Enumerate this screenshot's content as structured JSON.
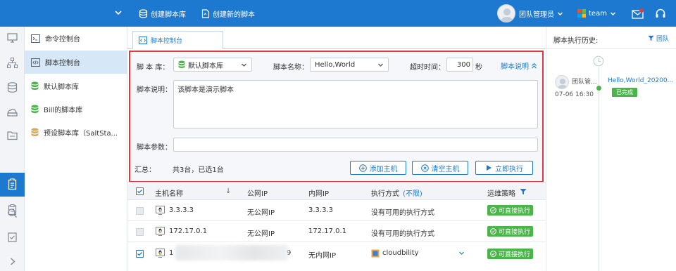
{
  "topbar": {
    "create_lib": "创建脚本库",
    "create_script": "创建新的脚本",
    "user_name": "团队管理员",
    "team_name": "team"
  },
  "sidebar": {
    "items": [
      {
        "label": "命令控制台",
        "icon": "terminal-icon"
      },
      {
        "label": "脚本控制台",
        "icon": "code-icon",
        "active": true
      },
      {
        "label": "默认脚本库",
        "icon": "database-icon",
        "color": "#4ab549"
      },
      {
        "label": "Bill的脚本库",
        "icon": "database-icon",
        "color": "#4ab549"
      },
      {
        "label": "预设脚本库（SaltSta...",
        "icon": "database-icon",
        "color": "#e0a64e"
      }
    ]
  },
  "tab": {
    "label": "脚本控制台"
  },
  "form": {
    "lib_label": "脚 本 库：",
    "lib_value": "默认脚本库",
    "name_label": "脚本名称：",
    "name_value": "Hello,World",
    "timeout_label": "超时时间：",
    "timeout_value": "300",
    "timeout_unit": "秒",
    "desc_toggle": "脚本说明",
    "desc_label": "脚本说明：",
    "desc_value": "该脚本是演示脚本",
    "param_label": "脚本参数：",
    "param_value": ""
  },
  "summary": {
    "label": "汇总：",
    "text": "共3台，已选1台",
    "add_host": "添加主机",
    "clear_host": "清空主机",
    "run_now": "立即执行"
  },
  "table": {
    "headers": {
      "host": "主机名称",
      "sort": "↓",
      "public_ip": "公网IP",
      "private_ip": "内网IP",
      "method": "执行方式",
      "method_filter": "(不限)",
      "policy": "运维策略"
    },
    "rows": [
      {
        "host": "3.3.3.3",
        "public_ip": "无公网IP",
        "private_ip": "3.3.3.3",
        "method": "没有可用的执行方式",
        "policy": "可直接执行",
        "checked": false,
        "disabled": true
      },
      {
        "host": "172.17.0.1",
        "public_ip": "无公网IP",
        "private_ip": "172.17.0.1",
        "method": "没有可用的执行方式",
        "policy": "可直接执行",
        "checked": false,
        "disabled": true
      },
      {
        "host": "1",
        "host_tail": "9",
        "public_ip": "无内网IP",
        "private_ip": "",
        "method": "cloudbility",
        "policy": "可直接执行",
        "checked": true,
        "disabled": false
      }
    ]
  },
  "history": {
    "title": "脚本执行历史:",
    "filter_label": "团队",
    "entries": [
      {
        "user": "团队管...",
        "time": "07-06 16:30",
        "script": "Hello,World_20200...",
        "status": "已完成"
      }
    ]
  },
  "colors": {
    "primary": "#1d78cf",
    "success": "#4ab549",
    "highlight_box": "#e2383d"
  }
}
